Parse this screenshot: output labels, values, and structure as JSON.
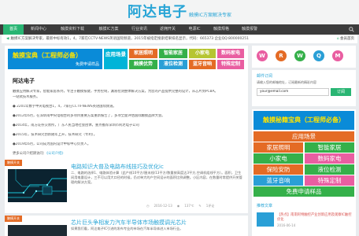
{
  "header": {
    "logo_main": "阿达电子",
    "logo_sub": "触摸IC方案解决专家"
  },
  "nav": {
    "items": [
      {
        "label": "首页",
        "active": true
      },
      {
        "label": "新闻中心"
      },
      {
        "label": "触摸资料下载"
      },
      {
        "label": "触摸IC方案"
      },
      {
        "label": "行业资讯"
      },
      {
        "label": "返佣开关"
      },
      {
        "label": "电源IC"
      },
      {
        "label": "触摸规格"
      },
      {
        "label": "触摸报警"
      }
    ]
  },
  "ticker": {
    "text": "触摸IC方案解决专家，最新中标有效1，4，7家在CCTV-NEWS英语国际频道，2015年被指定搜索结果排名显示，代码：665373 企业QQ:800000251",
    "home": "会员首页"
  },
  "banner": {
    "title": "触摸宝典（工程师必备）",
    "subtitle": "免费申请样品",
    "app": "应用场景",
    "cells": [
      {
        "label": "家居照明",
        "color": "#e46b25"
      },
      {
        "label": "智能家居",
        "color": "#35b04a"
      },
      {
        "label": "小家电",
        "color": "#b6c531"
      },
      {
        "label": "数码家电",
        "color": "#e95ea1"
      },
      {
        "label": "触摸优势",
        "color": "#35b04a"
      },
      {
        "label": "液位检测",
        "color": "#2a9fd6"
      },
      {
        "label": "蓝牙音响",
        "color": "#e46b25"
      },
      {
        "label": "特殊定制",
        "color": "#e95ea1"
      }
    ]
  },
  "intro": {
    "title": "阿达电子",
    "paragraphs": [
      "触摸应用解决专家，智能家居系列，专注于触摸按键，手势控制，漏液检测整体解决方案，为您的产品提供完整的设计，从芯片到PCBA。",
      "一站式技术服务。",
      "● 2201年数字中央电视台1，4，7家在CCTV-NEWS英语国际频道。",
      "●2012年6月，在深圳南中央电视台的多项目重要方案重新报告了，多项全面评估国际触摸品牌大会。",
      "●2014年，南方证券交易所，广东人民当地社会团体，重点推荐深圳市阿达电子公司",
      "●2015年，技术研究创新随年上升，技术研究（专利）。",
      "●2019年6月，公司成为国内设计中标中心负责人。"
    ],
    "more_prefix": "更多公司介绍请访问：",
    "more_link": "《公司介绍》"
  },
  "articles": [
    {
      "badge": "触摸开关",
      "title": "电路知识大普及电路布线技巧及优化ic",
      "summary": "二、电路的选择1、电路体验计算（此产线10平方/厘米线/13平方/数量按高度达3平方,空调机组线平方）。面积，卫生间用电量设计，三不可以用大口径的时候，仍对单大的户空间设计的面积比例调整。小区内容，在数量时常提供开关管理的解决方案。",
      "date": "2016-12-13",
      "views": "137℃",
      "comments": "1评论"
    },
    {
      "badge": "触摸开关",
      "title": "芯片巨头争相发力汽车半导体市场触摸调光芯片",
      "summary": "如果我们看，阿达电子IC引进的发布专业的市场在汽车半导体进入市场行业。",
      "date": "",
      "views": "",
      "comments": ""
    }
  ],
  "sidebar": {
    "social": [
      {
        "name": "weibo-icon",
        "glyph": "W",
        "color": "#e95ea1"
      },
      {
        "name": "rss-icon",
        "glyph": "R",
        "color": "#e46b25"
      },
      {
        "name": "wechat-icon",
        "glyph": "W",
        "color": "#35b04a"
      },
      {
        "name": "qq-icon",
        "glyph": "Q",
        "color": "#2a9fd6"
      },
      {
        "name": "mail-icon",
        "glyph": "M",
        "color": "#e95ea1"
      }
    ],
    "subscribe": {
      "title": "邮件订阅",
      "desc": "请输入您的邮箱地址，订阅最新的精彩内容",
      "placeholder": "your@email.com",
      "button": "订阅"
    },
    "card": {
      "title": "触摸秘籍宝典（工程师必备）",
      "app": "应用场景",
      "rows": [
        [
          {
            "label": "家居照明",
            "color": "#e46b25"
          },
          {
            "label": "智能家居",
            "color": "#35b04a"
          }
        ],
        [
          {
            "label": "小家电",
            "color": "#35b04a"
          },
          {
            "label": "数码家电",
            "color": "#e95ea1"
          }
        ],
        [
          {
            "label": "保险安防",
            "color": "#e46b25"
          },
          {
            "label": "液位检测",
            "color": "#35b04a"
          }
        ],
        [
          {
            "label": "蓝牙音响",
            "color": "#2a9fd6"
          },
          {
            "label": "特殊定制",
            "color": "#e95ea1"
          }
        ]
      ],
      "sample": "免费申请样品"
    },
    "news": {
      "title": "推荐文章",
      "text": "【热点】南南阿特触控产业创新应用及观察IC触控优化",
      "date": "2016-06-14",
      "views": "热度"
    }
  }
}
